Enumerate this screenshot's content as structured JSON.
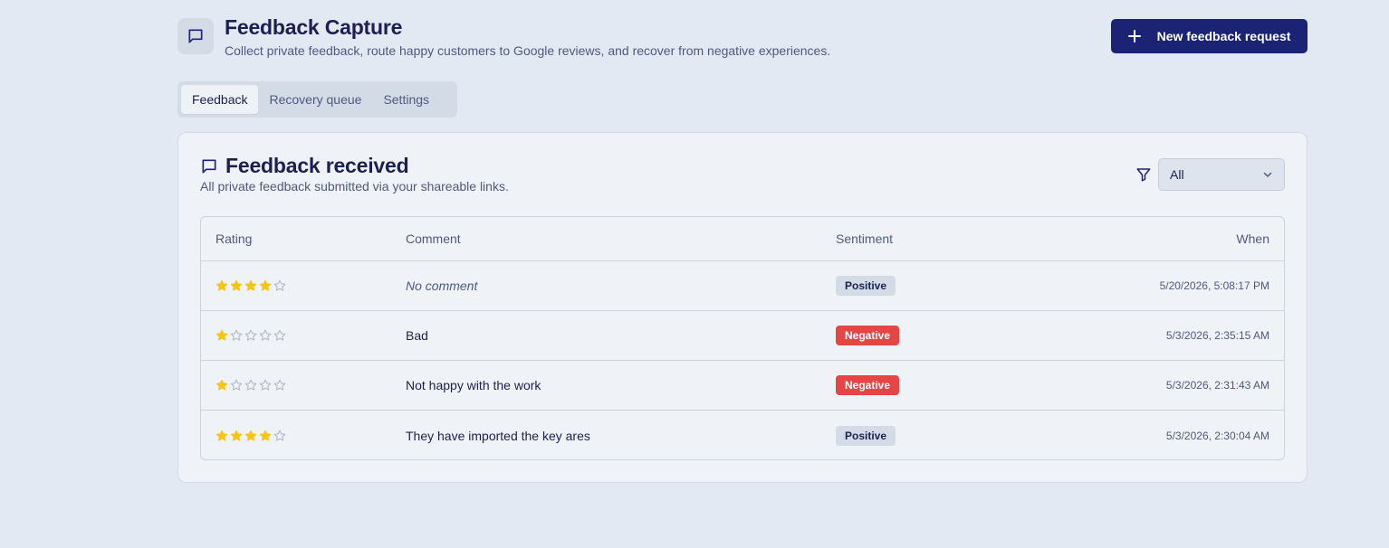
{
  "header": {
    "title": "Feedback Capture",
    "subtitle": "Collect private feedback, route happy customers to Google reviews, and recover from negative experiences.",
    "new_button_label": "New feedback request",
    "app_icon": "message-square-icon"
  },
  "tabs": [
    {
      "label": "Feedback",
      "active": true
    },
    {
      "label": "Recovery queue",
      "active": false
    },
    {
      "label": "Settings",
      "active": false
    }
  ],
  "card": {
    "title": "Feedback received",
    "subtitle": "All private feedback submitted via your shareable links.",
    "filter": {
      "icon": "filter-icon",
      "selected": "All"
    }
  },
  "table": {
    "columns": [
      "Rating",
      "Comment",
      "Sentiment",
      "When"
    ],
    "rows": [
      {
        "rating": 4,
        "comment": "No comment",
        "comment_empty": true,
        "sentiment": "Positive",
        "when": "5/20/2026, 5:08:17 PM"
      },
      {
        "rating": 1,
        "comment": "Bad",
        "comment_empty": false,
        "sentiment": "Negative",
        "when": "5/3/2026, 2:35:15 AM"
      },
      {
        "rating": 1,
        "comment": "Not happy with the work",
        "comment_empty": false,
        "sentiment": "Negative",
        "when": "5/3/2026, 2:31:43 AM"
      },
      {
        "rating": 4,
        "comment": "They have imported the key ares",
        "comment_empty": false,
        "sentiment": "Positive",
        "when": "5/3/2026, 2:30:04 AM"
      }
    ]
  },
  "colors": {
    "primary": "#1b2375",
    "star_filled": "#f5c518",
    "star_empty": "#a9b3c4",
    "negative": "#e54545",
    "positive_bg": "#d3dbe7"
  }
}
